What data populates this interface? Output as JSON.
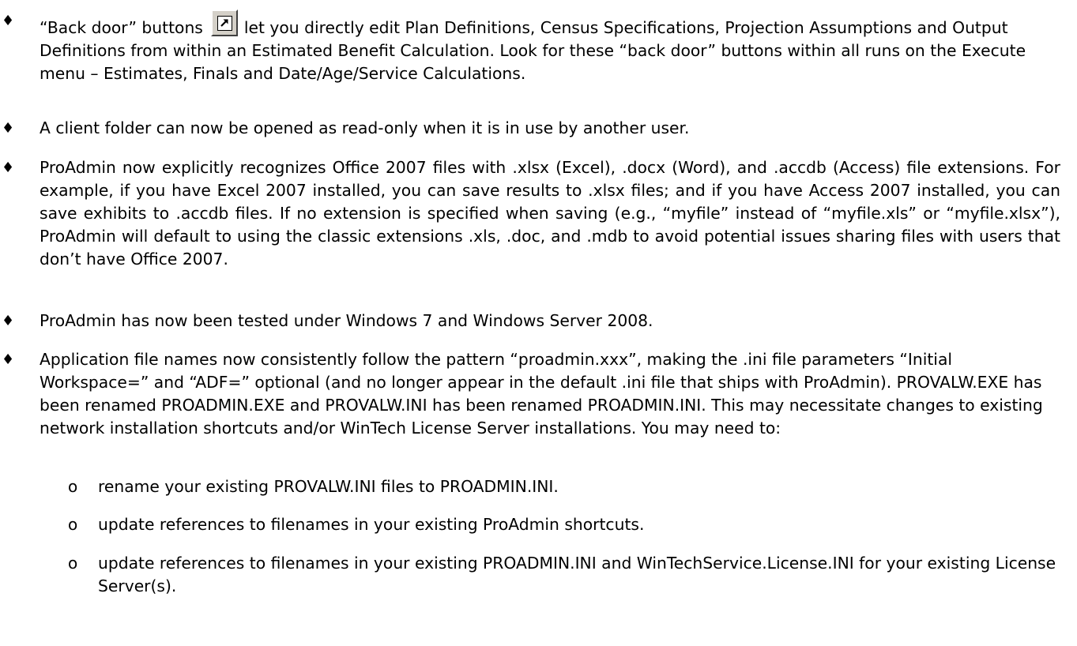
{
  "bullets": {
    "b1": {
      "before_icon": "“Back door” buttons",
      "icon": "shortcut-arrow-icon",
      "after_icon": "let you directly edit Plan Definitions, Census Specifications, Projection Assumptions and Output Definitions from within an Estimated Benefit Calculation.  Look for these “back door” buttons within all runs on the Execute menu – Estimates, Finals and Date/Age/Service Calculations."
    },
    "b2": {
      "text": "A client folder can now be opened as read-only when it is in use by another user."
    },
    "b3": {
      "text": "ProAdmin now explicitly recognizes Office 2007 files with .xlsx (Excel), .docx (Word), and .accdb (Access) file extensions.  For example, if you have Excel 2007 installed, you can save results to .xlsx files; and if you have Access 2007 installed, you can save exhibits to .accdb files.  If no extension is specified when saving (e.g., “myfile” instead of “myfile.xls” or “myfile.xlsx”), ProAdmin will default to using the classic extensions .xls, .doc, and .mdb to avoid potential issues sharing files with users that don’t have Office 2007."
    },
    "b4": {
      "text": "ProAdmin has now been tested under Windows 7 and Windows Server 2008."
    },
    "b5": {
      "text": "Application file names now consistently follow the pattern “proadmin.xxx”, making the .ini file parameters “Initial Workspace=” and “ADF=” optional (and no longer appear in the default .ini file that ships with ProAdmin).  PROVALW.EXE has been renamed PROADMIN.EXE and PROVALW.INI has been renamed PROADMIN.INI.  This may necessitate changes to existing network installation shortcuts and/or WinTech License Server installations. You may need to:",
      "sub": [
        "rename your existing PROVALW.INI files to PROADMIN.INI.",
        "update references to filenames in your existing ProAdmin shortcuts.",
        "update references to filenames in your existing PROADMIN.INI and WinTechService.License.INI for your existing License Server(s)."
      ]
    }
  },
  "symbols": {
    "bullet": "♦",
    "sub_bullet": "o"
  }
}
